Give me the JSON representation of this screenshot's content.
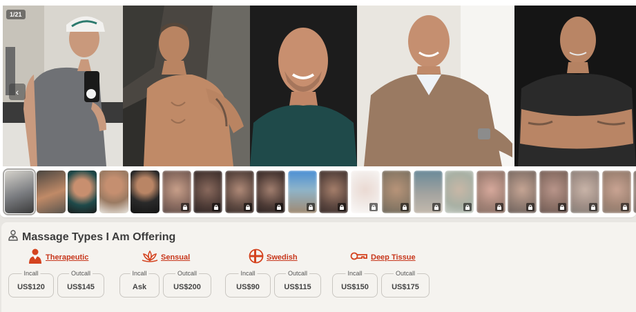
{
  "gallery": {
    "counter": "1/21",
    "main_photos": [
      {
        "name": "photo-selfie-cap"
      },
      {
        "name": "photo-shirtless-rocks"
      },
      {
        "name": "photo-portrait-green"
      },
      {
        "name": "photo-portrait-sweater"
      },
      {
        "name": "photo-arms-crossed"
      }
    ],
    "thumbnail_count": 21,
    "locked_from_index": 5
  },
  "services": {
    "title": "Massage Types I Am Offering",
    "types": [
      {
        "label": "Therapeutic",
        "icon": "therapist-icon",
        "incall_label": "Incall",
        "incall": "US$120",
        "outcall_label": "Outcall",
        "outcall": "US$145"
      },
      {
        "label": "Sensual",
        "icon": "lotus-icon",
        "incall_label": "Incall",
        "incall": "Ask",
        "outcall_label": "Outcall",
        "outcall": "US$200"
      },
      {
        "label": "Swedish",
        "icon": "swedish-cross-icon",
        "incall_label": "Incall",
        "incall": "US$90",
        "outcall_label": "Outcall",
        "outcall": "US$115"
      },
      {
        "label": "Deep Tissue",
        "icon": "key-hand-icon",
        "incall_label": "Incall",
        "incall": "US$150",
        "outcall_label": "Outcall",
        "outcall": "US$175"
      }
    ]
  },
  "colors": {
    "accent": "#c7361b",
    "card": "#f5f3ef",
    "border": "#c9c6c1"
  }
}
